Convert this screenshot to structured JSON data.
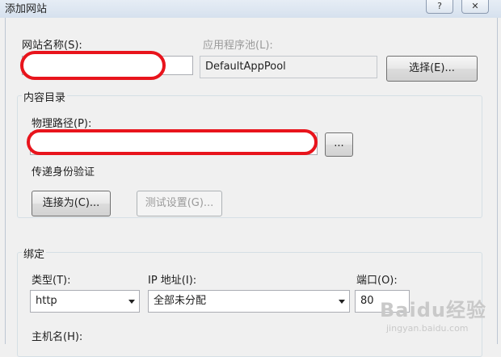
{
  "window": {
    "title": "添加网站",
    "help_glyph": "?",
    "close_glyph": "✕"
  },
  "site": {
    "site_name_label": "网站名称(S):",
    "site_name_value": "",
    "app_pool_label": "应用程序池(L):",
    "app_pool_value": "DefaultAppPool",
    "select_button": "选择(E)..."
  },
  "content": {
    "group_label": "内容目录",
    "physical_path_label": "物理路径(P):",
    "physical_path_value": "",
    "browse_button": "...",
    "passthrough_label": "传递身份验证",
    "connect_as_button": "连接为(C)...",
    "test_settings_button": "测试设置(G)..."
  },
  "binding": {
    "group_label": "绑定",
    "type_label": "类型(T):",
    "type_value": "http",
    "ip_label": "IP 地址(I):",
    "ip_value": "全部未分配",
    "port_label": "端口(O):",
    "port_value": "80",
    "host_label": "主机名(H):"
  },
  "watermark": {
    "logo": "Baidu经验",
    "url": "jingyan.baidu.com"
  },
  "colors": {
    "redaction": "#e8141c",
    "dialog_bg": "#f0f0f0"
  }
}
